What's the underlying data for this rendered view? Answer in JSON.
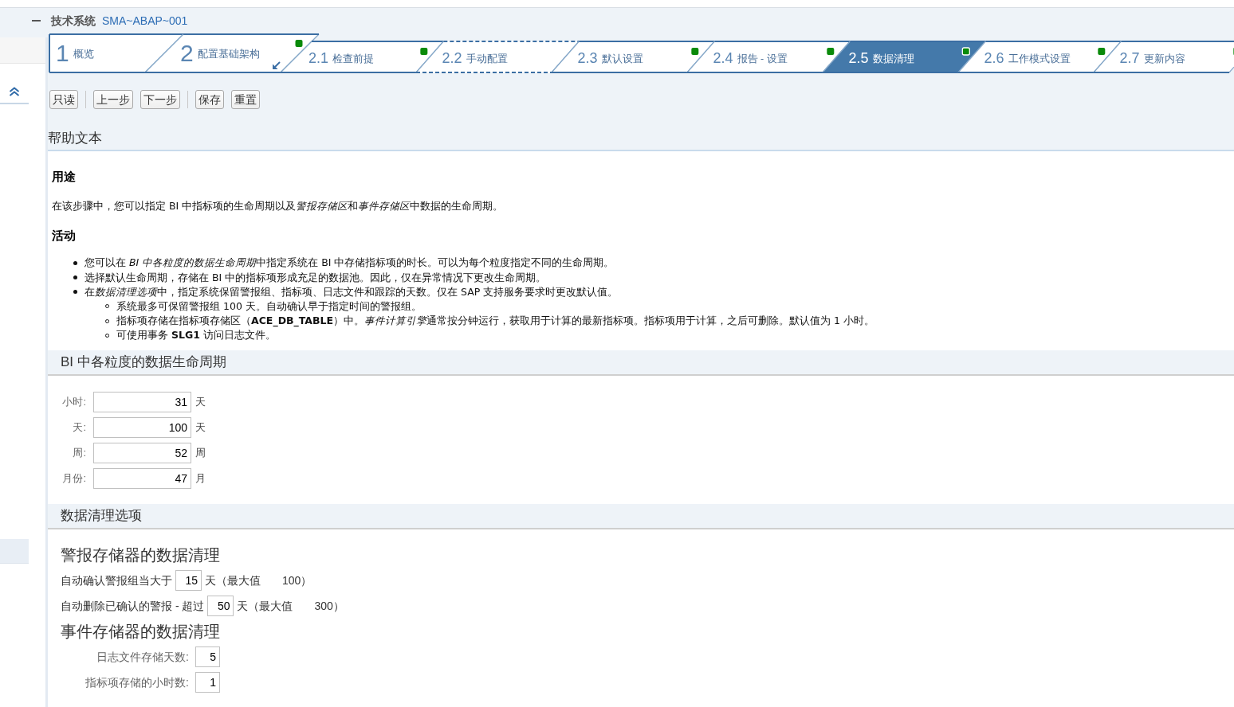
{
  "header": {
    "expanded": true,
    "label": "技术系统",
    "system": "SMA~ABAP~001"
  },
  "wizard": {
    "steps": [
      {
        "kind": "main",
        "number": "1",
        "label": "概览",
        "selected": false,
        "done": false,
        "expanded": false,
        "focused": false
      },
      {
        "kind": "main",
        "number": "2",
        "label": "配置基础架构",
        "selected": false,
        "done": true,
        "expanded": true,
        "focused": false
      },
      {
        "kind": "sub",
        "number": "2.1",
        "label": "检查前提",
        "selected": false,
        "done": true,
        "expanded": false,
        "focused": false
      },
      {
        "kind": "sub",
        "number": "2.2",
        "label": "手动配置",
        "selected": false,
        "done": false,
        "expanded": false,
        "focused": true
      },
      {
        "kind": "sub",
        "number": "2.3",
        "label": "默认设置",
        "selected": false,
        "done": true,
        "expanded": false,
        "focused": false
      },
      {
        "kind": "sub",
        "number": "2.4",
        "label": "报告 - 设置",
        "selected": false,
        "done": true,
        "expanded": false,
        "focused": false
      },
      {
        "kind": "sub",
        "number": "2.5",
        "label": "数据清理",
        "selected": true,
        "done": true,
        "expanded": false,
        "focused": false
      },
      {
        "kind": "sub",
        "number": "2.6",
        "label": "工作模式设置",
        "selected": false,
        "done": true,
        "expanded": false,
        "focused": false
      },
      {
        "kind": "sub",
        "number": "2.7",
        "label": "更新内容",
        "selected": false,
        "done": true,
        "expanded": false,
        "focused": false
      }
    ]
  },
  "toolbar": {
    "groups": [
      [
        "只读"
      ],
      [
        "上一步",
        "下一步"
      ],
      [
        "保存",
        "重置"
      ]
    ]
  },
  "help": {
    "title": "帮助文本",
    "blocks": [
      {
        "kind": "heading",
        "text": "用途"
      },
      {
        "kind": "paragraph",
        "parts": [
          "在该步骤中，您可以指定 BI 中指标项的生命周期以及",
          "*警报存储区*",
          "和",
          "*事件存储区*",
          "中数据的生命周期。"
        ]
      },
      {
        "kind": "heading",
        "text": "活动"
      },
      {
        "kind": "list",
        "items": [
          {
            "parts": [
              "您可以在 ",
              "*BI 中各粒度的数据生命周期*",
              "中指定系统在 BI 中存储指标项的时长。可以为每个粒度指定不同的生命周期。"
            ]
          },
          {
            "parts": [
              "选择默认生命周期，存储在 BI 中的指标项形成充足的数据池。因此，仅在异常情况下更改生命周期。"
            ]
          },
          {
            "parts": [
              "在",
              "*数据清理选项*",
              "中，指定系统保留警报组、指标项、日志文件和跟踪的天数。仅在 SAP 支持服务要求时更改默认值。"
            ],
            "children": [
              {
                "parts": [
                  "系统最多可保留警报组 100 天。自动确认早于指定时间的警报组。"
                ]
              },
              {
                "parts": [
                  "指标项存储在指标项存储区（",
                  "**ACE_DB_TABLE**",
                  "）中。",
                  "*事件计算引擎*",
                  "通常按分钟运行，获取用于计算的最新指标项。指标项用于计算，之后可删除。默认值为 1 小时。"
                ]
              },
              {
                "parts": [
                  "可使用事务 ",
                  "**SLG1**",
                  " 访问日志文件。"
                ]
              }
            ]
          }
        ]
      }
    ]
  },
  "lifecycle": {
    "title": "BI 中各粒度的数据生命周期",
    "rows": [
      {
        "label": "小时:",
        "value": "31",
        "unit": "天"
      },
      {
        "label": "天:",
        "value": "100",
        "unit": "天"
      },
      {
        "label": "周:",
        "value": "52",
        "unit": "周"
      },
      {
        "label": "月份:",
        "value": "47",
        "unit": "月"
      }
    ]
  },
  "cleanup": {
    "title": "数据清理选项",
    "groups": [
      {
        "kind": "inline",
        "title": "警报存储器的数据清理",
        "rows": [
          {
            "label": "自动确认警报组当大于",
            "value": "15",
            "unit": "天（最大值",
            "max": "100）"
          },
          {
            "label": "自动删除已确认的警报 - 超过",
            "value": "50",
            "unit": "天（最大值",
            "max": "300）"
          }
        ]
      },
      {
        "kind": "labeled",
        "title": "事件存储器的数据清理",
        "rows": [
          {
            "label": "日志文件存储天数:",
            "value": "5"
          },
          {
            "label": "指标项存储的小时数:",
            "value": "1"
          }
        ]
      }
    ]
  }
}
